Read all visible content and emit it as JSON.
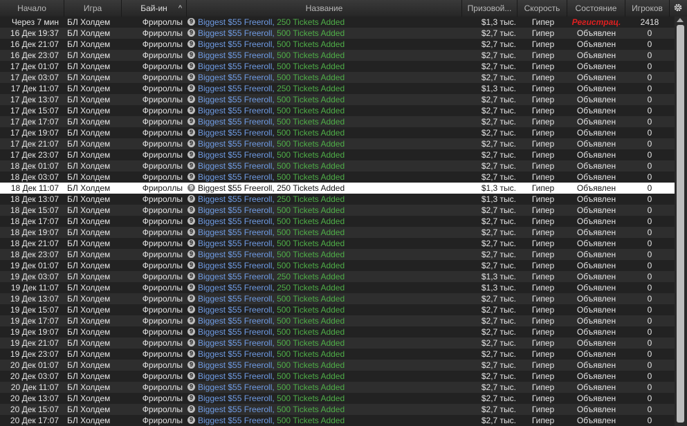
{
  "header": {
    "start": "Начало",
    "game": "Игра",
    "buyin": "Бай-ин",
    "sort_indicator": "^",
    "name": "Название",
    "prize": "Призовой...",
    "speed": "Скорость",
    "state": "Состояние",
    "players": "Игроков",
    "settings_icon": "gear-icon"
  },
  "common": {
    "game": "БЛ Холдем",
    "buyin": "Фрироллы",
    "badge": "9",
    "speed": "Гипер",
    "name_part1": "Biggest $55 Freeroll,"
  },
  "rows": [
    {
      "start": "Через 7 мин",
      "tickets": "250 Tickets Added",
      "prize": "$1,3 тыс.",
      "state": "Регистрац.",
      "players": "2418",
      "status": "registering"
    },
    {
      "start": "16 Дек  19:37",
      "tickets": "500 Tickets Added",
      "prize": "$2,7 тыс.",
      "state": "Объявлен",
      "players": "0"
    },
    {
      "start": "16 Дек  21:07",
      "tickets": "500 Tickets Added",
      "prize": "$2,7 тыс.",
      "state": "Объявлен",
      "players": "0"
    },
    {
      "start": "16 Дек  23:07",
      "tickets": "500 Tickets Added",
      "prize": "$2,7 тыс.",
      "state": "Объявлен",
      "players": "0"
    },
    {
      "start": "17 Дек  01:07",
      "tickets": "500 Tickets Added",
      "prize": "$2,7 тыс.",
      "state": "Объявлен",
      "players": "0"
    },
    {
      "start": "17 Дек  03:07",
      "tickets": "500 Tickets Added",
      "prize": "$2,7 тыс.",
      "state": "Объявлен",
      "players": "0"
    },
    {
      "start": "17 Дек  11:07",
      "tickets": "250 Tickets Added",
      "prize": "$1,3 тыс.",
      "state": "Объявлен",
      "players": "0"
    },
    {
      "start": "17 Дек  13:07",
      "tickets": "500 Tickets Added",
      "prize": "$2,7 тыс.",
      "state": "Объявлен",
      "players": "0"
    },
    {
      "start": "17 Дек  15:07",
      "tickets": "500 Tickets Added",
      "prize": "$2,7 тыс.",
      "state": "Объявлен",
      "players": "0"
    },
    {
      "start": "17 Дек  17:07",
      "tickets": "500 Tickets Added",
      "prize": "$2,7 тыс.",
      "state": "Объявлен",
      "players": "0"
    },
    {
      "start": "17 Дек  19:07",
      "tickets": "500 Tickets Added",
      "prize": "$2,7 тыс.",
      "state": "Объявлен",
      "players": "0"
    },
    {
      "start": "17 Дек  21:07",
      "tickets": "500 Tickets Added",
      "prize": "$2,7 тыс.",
      "state": "Объявлен",
      "players": "0"
    },
    {
      "start": "17 Дек  23:07",
      "tickets": "500 Tickets Added",
      "prize": "$2,7 тыс.",
      "state": "Объявлен",
      "players": "0"
    },
    {
      "start": "18 Дек  01:07",
      "tickets": "500 Tickets Added",
      "prize": "$2,7 тыс.",
      "state": "Объявлен",
      "players": "0"
    },
    {
      "start": "18 Дек  03:07",
      "tickets": "500 Tickets Added",
      "prize": "$2,7 тыс.",
      "state": "Объявлен",
      "players": "0"
    },
    {
      "start": "18 Дек  11:07",
      "tickets": "250 Tickets Added",
      "prize": "$1,3 тыс.",
      "state": "Объявлен",
      "players": "0",
      "selected": true
    },
    {
      "start": "18 Дек  13:07",
      "tickets": "250 Tickets Added",
      "prize": "$1,3 тыс.",
      "state": "Объявлен",
      "players": "0"
    },
    {
      "start": "18 Дек  15:07",
      "tickets": "500 Tickets Added",
      "prize": "$2,7 тыс.",
      "state": "Объявлен",
      "players": "0"
    },
    {
      "start": "18 Дек  17:07",
      "tickets": "500 Tickets Added",
      "prize": "$2,7 тыс.",
      "state": "Объявлен",
      "players": "0"
    },
    {
      "start": "18 Дек  19:07",
      "tickets": "500 Tickets Added",
      "prize": "$2,7 тыс.",
      "state": "Объявлен",
      "players": "0"
    },
    {
      "start": "18 Дек  21:07",
      "tickets": "500 Tickets Added",
      "prize": "$2,7 тыс.",
      "state": "Объявлен",
      "players": "0"
    },
    {
      "start": "18 Дек  23:07",
      "tickets": "500 Tickets Added",
      "prize": "$2,7 тыс.",
      "state": "Объявлен",
      "players": "0"
    },
    {
      "start": "19 Дек  01:07",
      "tickets": "500 Tickets Added",
      "prize": "$2,7 тыс.",
      "state": "Объявлен",
      "players": "0"
    },
    {
      "start": "19 Дек  03:07",
      "tickets": "250 Tickets Added",
      "prize": "$1,3 тыс.",
      "state": "Объявлен",
      "players": "0"
    },
    {
      "start": "19 Дек  11:07",
      "tickets": "250 Tickets Added",
      "prize": "$1,3 тыс.",
      "state": "Объявлен",
      "players": "0"
    },
    {
      "start": "19 Дек  13:07",
      "tickets": "500 Tickets Added",
      "prize": "$2,7 тыс.",
      "state": "Объявлен",
      "players": "0"
    },
    {
      "start": "19 Дек  15:07",
      "tickets": "500 Tickets Added",
      "prize": "$2,7 тыс.",
      "state": "Объявлен",
      "players": "0"
    },
    {
      "start": "19 Дек  17:07",
      "tickets": "500 Tickets Added",
      "prize": "$2,7 тыс.",
      "state": "Объявлен",
      "players": "0"
    },
    {
      "start": "19 Дек  19:07",
      "tickets": "500 Tickets Added",
      "prize": "$2,7 тыс.",
      "state": "Объявлен",
      "players": "0"
    },
    {
      "start": "19 Дек  21:07",
      "tickets": "500 Tickets Added",
      "prize": "$2,7 тыс.",
      "state": "Объявлен",
      "players": "0"
    },
    {
      "start": "19 Дек  23:07",
      "tickets": "500 Tickets Added",
      "prize": "$2,7 тыс.",
      "state": "Объявлен",
      "players": "0"
    },
    {
      "start": "20 Дек  01:07",
      "tickets": "500 Tickets Added",
      "prize": "$2,7 тыс.",
      "state": "Объявлен",
      "players": "0"
    },
    {
      "start": "20 Дек  03:07",
      "tickets": "500 Tickets Added",
      "prize": "$2,7 тыс.",
      "state": "Объявлен",
      "players": "0"
    },
    {
      "start": "20 Дек  11:07",
      "tickets": "500 Tickets Added",
      "prize": "$2,7 тыс.",
      "state": "Объявлен",
      "players": "0"
    },
    {
      "start": "20 Дек  13:07",
      "tickets": "500 Tickets Added",
      "prize": "$2,7 тыс.",
      "state": "Объявлен",
      "players": "0"
    },
    {
      "start": "20 Дек  15:07",
      "tickets": "500 Tickets Added",
      "prize": "$2,7 тыс.",
      "state": "Объявлен",
      "players": "0"
    },
    {
      "start": "20 Дек  17:07",
      "tickets": "500 Tickets Added",
      "prize": "$2,7 тыс.",
      "state": "Объявлен",
      "players": "0"
    }
  ]
}
